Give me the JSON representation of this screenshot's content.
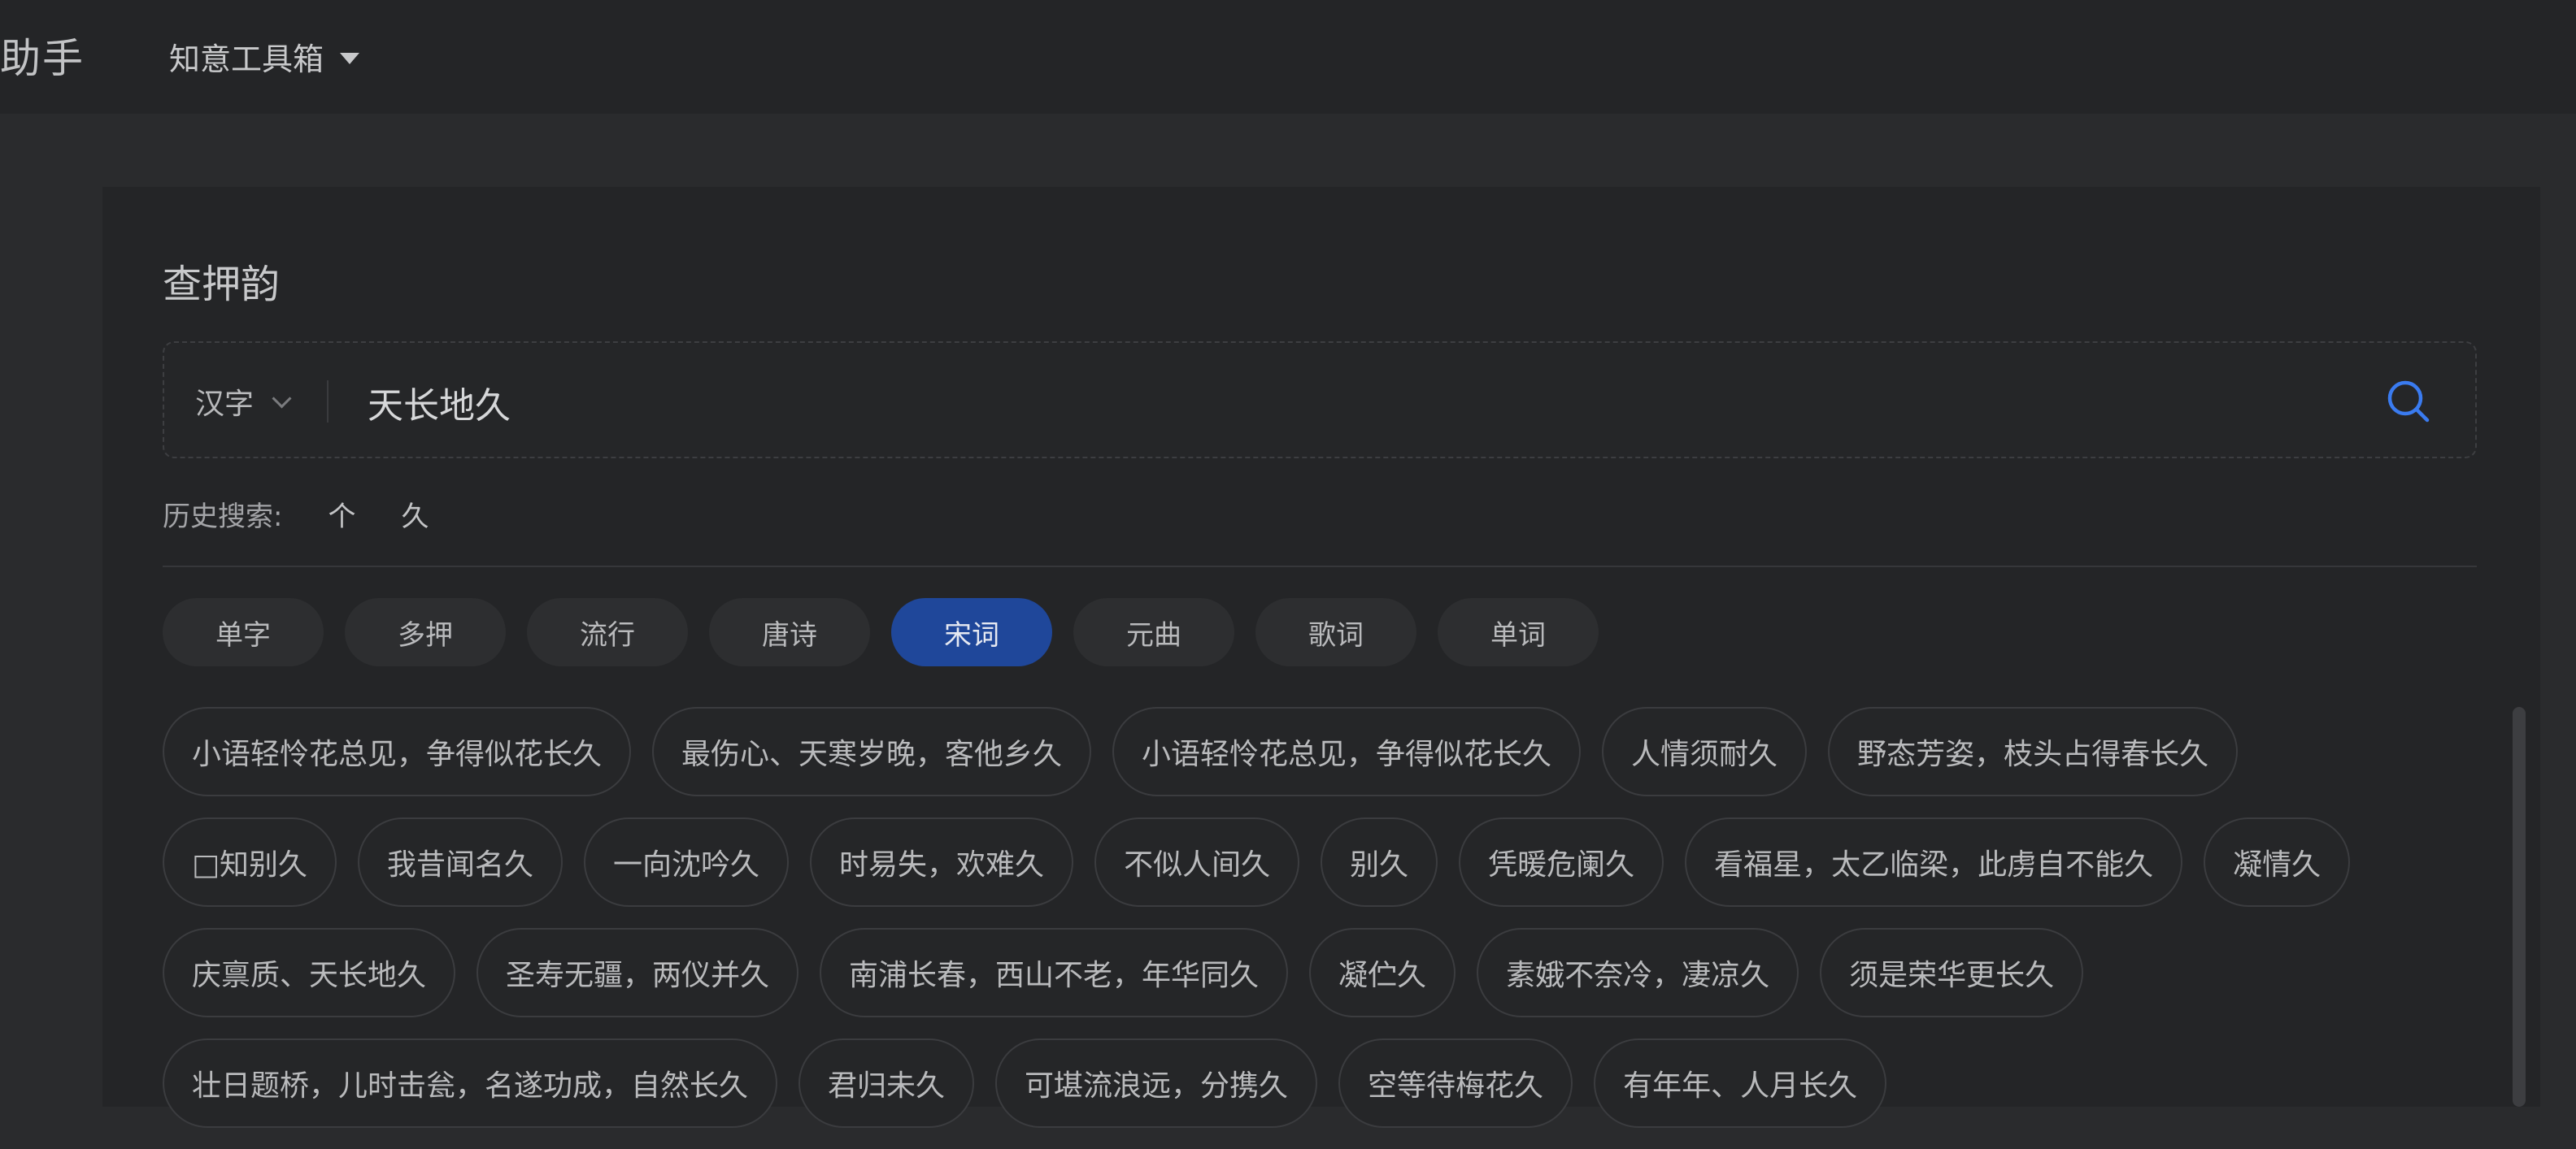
{
  "header": {
    "brand": "助手",
    "menu_label": "知意工具箱"
  },
  "panel": {
    "title": "查押韵",
    "search": {
      "type_label": "汉字",
      "value": "天长地久"
    },
    "history": {
      "label": "历史搜索:",
      "items": [
        "个",
        "久"
      ]
    },
    "tabs": [
      {
        "label": "单字",
        "active": false
      },
      {
        "label": "多押",
        "active": false
      },
      {
        "label": "流行",
        "active": false
      },
      {
        "label": "唐诗",
        "active": false
      },
      {
        "label": "宋词",
        "active": true
      },
      {
        "label": "元曲",
        "active": false
      },
      {
        "label": "歌词",
        "active": false
      },
      {
        "label": "单词",
        "active": false
      }
    ],
    "results": [
      [
        "小语轻怜花总见，争得似花长久",
        "最伤心、天寒岁晚，客他乡久",
        "小语轻怜花总见，争得似花长久",
        "人情须耐久",
        "野态芳姿，枝头占得春长久"
      ],
      [
        "□知别久",
        "我昔闻名久",
        "一向沈吟久",
        "时易失，欢难久",
        "不似人间久",
        "别久",
        "凭暖危阑久",
        "看福星，太乙临梁，此虏自不能久",
        "凝情久"
      ],
      [
        "庆禀质、天长地久",
        "圣寿无疆，两仪并久",
        "南浦长春，西山不老，年华同久",
        "凝伫久",
        "素娥不奈冷，凄凉久",
        "须是荣华更长久"
      ],
      [
        "壮日题桥，儿时击瓮，名遂功成，自然长久",
        "君归未久",
        "可堪流浪远，分携久",
        "空等待梅花久",
        "有年年、人月长久"
      ]
    ]
  },
  "colors": {
    "active_tab": "#1f479a",
    "search_icon": "#3a7bf0",
    "background": "#2a2b2d",
    "panel": "#242527"
  }
}
